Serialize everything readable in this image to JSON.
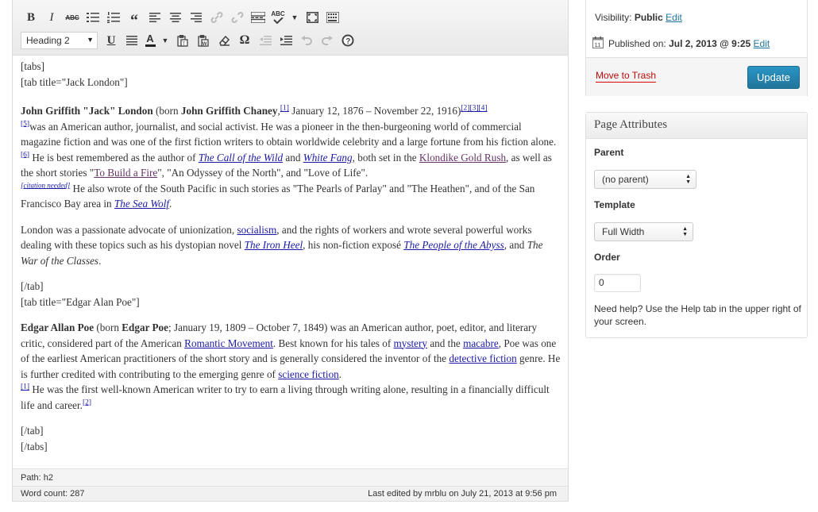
{
  "toolbar": {
    "format_select": "Heading 2",
    "row1_icons": [
      "bold-icon",
      "italic-icon",
      "strikethrough-icon",
      "bullet-list-icon",
      "numbered-list-icon",
      "blockquote-icon",
      "align-left-icon",
      "align-center-icon",
      "align-right-icon",
      "insert-link-icon",
      "unlink-icon",
      "more-tag-icon",
      "spellcheck-icon",
      "fullscreen-icon",
      "kitchen-sink-icon"
    ],
    "row2_icons": [
      "underline-icon",
      "justify-icon",
      "text-color-icon",
      "paste-text-icon",
      "paste-word-icon",
      "clear-format-icon",
      "special-char-icon",
      "outdent-icon",
      "indent-icon",
      "undo-icon",
      "redo-icon",
      "help-icon"
    ],
    "bold": "B",
    "italic": "I",
    "strike": "ABC",
    "spell": "ABC",
    "underline": "U",
    "color_letter": "A",
    "omega": "Ω"
  },
  "content": {
    "tabs_open": "[tabs]",
    "tab1_open": "[tab title=\"Jack London\"]",
    "p1": {
      "name_bold1": "John Griffith \"Jack\" London",
      "t1": " (born ",
      "name_bold2": "John Griffith Chaney",
      "t2": ",",
      "ref1": "[1]",
      "t3": " January 12, 1876 – November 22, 1916)",
      "ref2": "[2]",
      "ref3": "[3]",
      "ref4": "[4]",
      "ref5": "[5]",
      "t4": "was an American author, journalist, and social activist. He was a pioneer in the then-burgeoning world of commercial magazine fiction and was one of the first fiction writers to obtain worldwide celebrity and a large fortune from his fiction alone.",
      "ref6": "[6]",
      "t5": " He is best remembered as the author of ",
      "link_call": "The Call of the Wild",
      "t6": " and ",
      "link_fang": "White Fang",
      "t7": ", both set in the ",
      "link_klondike": "Klondike Gold Rush",
      "t8": ", as well as the short stories \"",
      "link_fire": "To Build a Fire",
      "t9": "\", \"An Odyssey of the North\", and \"Love of Life\". ",
      "citation": "[citation needed]",
      "t10": " He also wrote of the South Pacific in such stories as \"The Pearls of Parlay\" and \"The Heathen\", and of the San Francisco Bay area in ",
      "link_seawolf": "The Sea Wolf",
      "t11": "."
    },
    "p2": {
      "t1": "London was a passionate advocate of unionization, ",
      "link_socialism": "socialism",
      "t2": ", and the rights of workers and wrote several powerful works dealing with these topics such as his dystopian novel ",
      "link_ironheel": "The Iron Heel",
      "t3": ", his non-fiction exposé ",
      "link_abyss": "The People of the Abyss",
      "t4": ", and ",
      "italic_war": "The War of the Classes",
      "t5": "."
    },
    "tab_close1": "[/tab]",
    "tab2_open": "[tab title=\"Edgar Alan Poe\"]",
    "p3": {
      "name_bold1": "Edgar Allan Poe",
      "t1": " (born ",
      "name_bold2": "Edgar Poe",
      "t2": "; January 19, 1809 – October 7, 1849) was an American author, poet, editor, and literary critic, considered part of the American ",
      "link_romantic": "Romantic Movement",
      "t3": ". Best known for his tales of ",
      "link_mystery": "mystery",
      "t4": " and the ",
      "link_macabre": "macabre",
      "t5": ", Poe was one of the earliest American practitioners of the short story and is generally considered the inventor of the ",
      "link_detective": "detective fiction",
      "t6": " genre. He is further credited with contributing to the emerging genre of ",
      "link_scifi": "science fiction",
      "t7": ". ",
      "ref1": "[1]",
      "t8": " He was the first well-known American writer to try to earn a living through writing alone, resulting in a financially difficult life and career.",
      "ref2": "[2]"
    },
    "tab_close2": "[/tab]",
    "tabs_close": "[/tabs]"
  },
  "status": {
    "path": "Path: h2",
    "word_count": "Word count: 287",
    "last_edited": "Last edited by mrblu on July 21, 2013 at 9:56 pm"
  },
  "publish": {
    "visibility_label": "Visibility:",
    "visibility_value": "Public",
    "edit": "Edit",
    "published_label": "Published on:",
    "published_value": "Jul 2, 2013 @ 9:25",
    "calendar_day": "11",
    "trash": "Move to Trash",
    "update": "Update"
  },
  "attributes": {
    "title": "Page Attributes",
    "parent_label": "Parent",
    "parent_value": "(no parent)",
    "template_label": "Template",
    "template_value": "Full Width",
    "order_label": "Order",
    "order_value": "0",
    "help": "Need help? Use the Help tab in the upper right of your screen."
  },
  "colors": {
    "link": "#21759b",
    "update_button": "#21759b",
    "trash": "#bc0b0b"
  }
}
